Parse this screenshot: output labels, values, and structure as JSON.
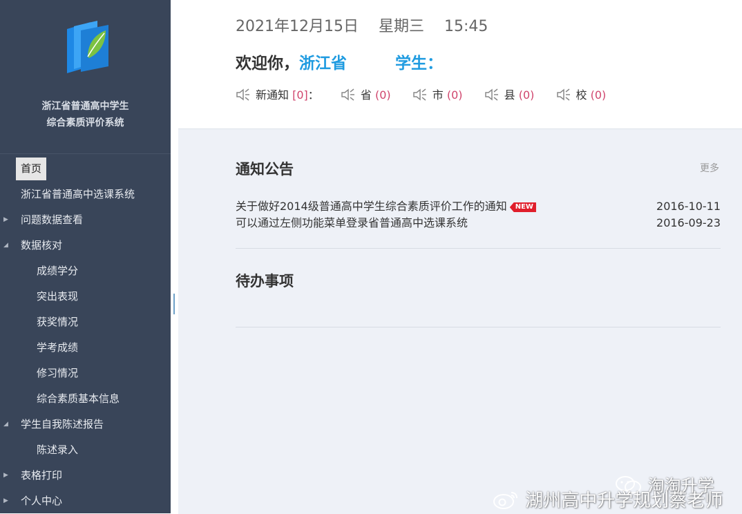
{
  "sidebar": {
    "system_name_line1": "浙江省普通高中学生",
    "system_name_line2": "综合素质评价系统",
    "menu": {
      "home": "首页",
      "course_selection": "浙江省普通高中选课系统",
      "problem_data": "问题数据查看",
      "data_check": "数据核对",
      "scores": "成绩学分",
      "outstanding": "突出表现",
      "awards": "获奖情况",
      "exam_scores": "学考成绩",
      "course_status": "修习情况",
      "basic_info": "综合素质基本信息",
      "self_report": "学生自我陈述报告",
      "statement_entry": "陈述录入",
      "form_print": "表格打印",
      "personal_center": "个人中心"
    }
  },
  "header": {
    "date": "2021年12月15日",
    "weekday": "星期三",
    "time": "15:45",
    "welcome_prefix": "欢迎你，",
    "welcome_user": "浙江省",
    "welcome_user_suffix": "学生：",
    "notices": {
      "new_label": "新通知",
      "new_count": "[0]",
      "colon": "：",
      "province_label": "省",
      "province_count": "(0)",
      "city_label": "市",
      "city_count": "(0)",
      "county_label": "县",
      "county_count": "(0)",
      "school_label": "校",
      "school_count": "(0)"
    }
  },
  "announcements": {
    "title": "通知公告",
    "more": "更多",
    "items": [
      {
        "text": "关于做好2014级普通高中学生综合素质评价工作的通知",
        "badge": "NEW",
        "date": "2016-10-11"
      },
      {
        "text": "可以通过左侧功能菜单登录省普通高中选课系统",
        "date": "2016-09-23"
      }
    ]
  },
  "todo": {
    "title": "待办事项"
  },
  "watermarks": {
    "wechat": "淘淘升学",
    "weibo": "湖州高中升学规划蔡老师"
  },
  "colors": {
    "sidebar_bg": "#394559",
    "accent_blue": "#1f9be0",
    "count_red": "#d0456d",
    "badge_red": "#e01e2b",
    "content_bg": "#eef1f7"
  }
}
